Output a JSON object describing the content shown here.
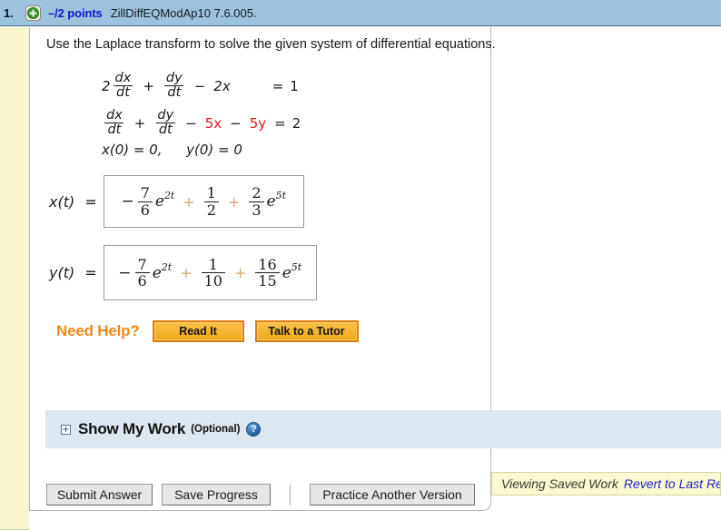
{
  "header": {
    "question_number": "1.",
    "expand_icon": "plus-circle-icon",
    "points": "–/2 points",
    "question_code": "ZillDiffEQModAp10 7.6.005.",
    "bar_color": "#9cc2de",
    "points_color": "#1414c8"
  },
  "question": {
    "prompt": "Use the Laplace transform to solve the given system of differential equations.",
    "system": {
      "equation1": {
        "coefficient": "2",
        "frac1_num": "dx",
        "frac1_den": "dt",
        "op1": "+",
        "frac2_num": "dy",
        "frac2_den": "dt",
        "op2": "−",
        "term1": "2x",
        "equals": "=",
        "rhs": "1"
      },
      "equation2": {
        "coefficient": "",
        "frac1_num": "dx",
        "frac1_den": "dt",
        "op1": "+",
        "frac2_num": "dy",
        "frac2_den": "dt",
        "op2": "−",
        "term1": "5x",
        "op3": "−",
        "term2": "5y",
        "equals": "=",
        "rhs": "2",
        "highlight_color": "#e01b1b"
      },
      "initial_conditions": {
        "x0": "x(0) = 0,",
        "y0": "y(0) = 0"
      }
    }
  },
  "answers": [
    {
      "label": "x(t)",
      "equals": "=",
      "expression": {
        "sign": "−",
        "frac1_num": "7",
        "frac1_den": "6",
        "exp1_base": "e",
        "exp1_power": "2t",
        "op1": "+",
        "frac2_num": "1",
        "frac2_den": "2",
        "op2": "+",
        "frac3_num": "2",
        "frac3_den": "3",
        "exp2_base": "e",
        "exp2_power": "5t"
      }
    },
    {
      "label": "y(t)",
      "equals": "=",
      "expression": {
        "sign": "−",
        "frac1_num": "7",
        "frac1_den": "6",
        "exp1_base": "e",
        "exp1_power": "2t",
        "op1": "+",
        "frac2_num": "1",
        "frac2_den": "10",
        "op2": "+",
        "frac3_num": "16",
        "frac3_den": "15",
        "exp2_base": "e",
        "exp2_power": "5t"
      }
    }
  ],
  "need_help": {
    "label": "Need Help?",
    "label_color": "#f08a1c",
    "buttons": [
      {
        "name": "read-it",
        "label": "Read It"
      },
      {
        "name": "talk-to-a-tutor",
        "label": "Talk to a Tutor"
      }
    ]
  },
  "show_my_work": {
    "expand_icon": "plus-box-icon",
    "expand_glyph": "+",
    "title": "Show My Work",
    "optional": "(Optional)",
    "help_icon": "question-mark-icon",
    "help_glyph": "?",
    "panel_color": "#dce7ef"
  },
  "footer": {
    "submit_label": "Submit Answer",
    "save_label": "Save Progress",
    "practice_label": "Practice Another Version"
  },
  "saved_work": {
    "status": "Viewing Saved Work",
    "revert_link": "Revert to Last Re",
    "banner_color": "#fbfad0"
  }
}
